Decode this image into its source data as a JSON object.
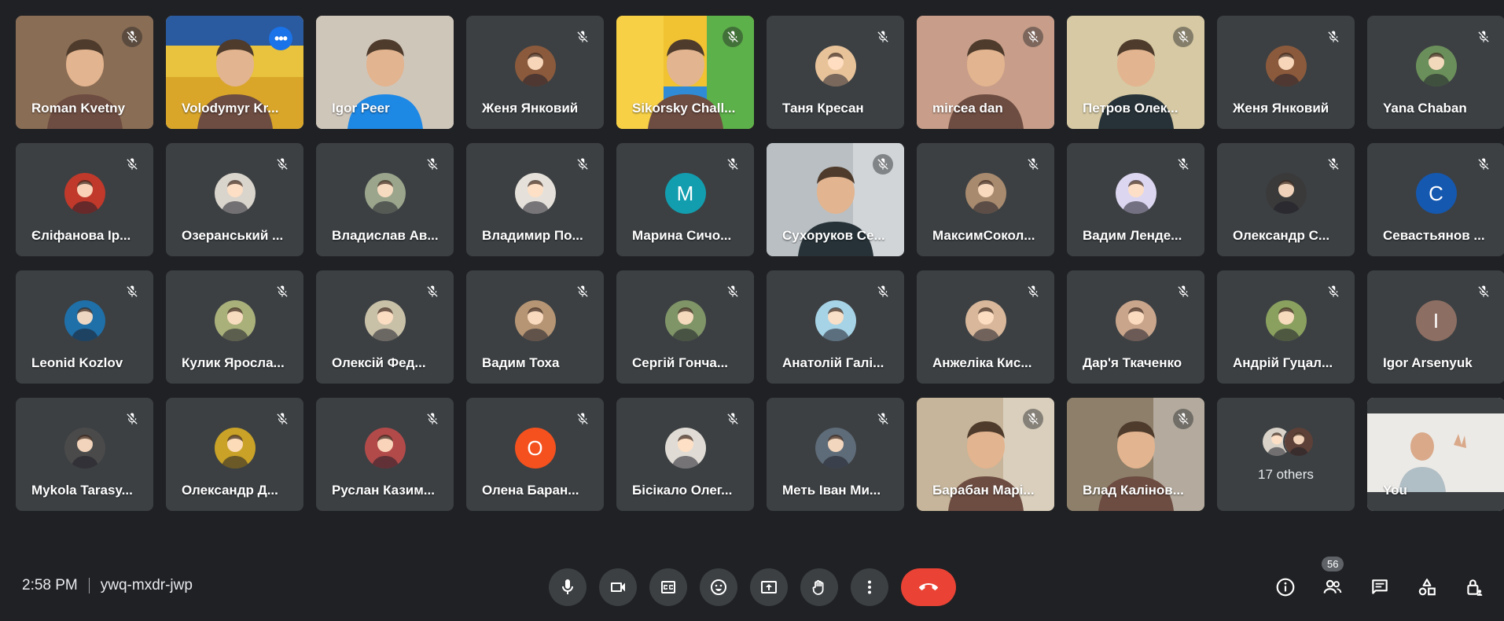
{
  "participants": [
    {
      "name": "Roman Kvetny",
      "type": "video",
      "muted": true,
      "bg": "#8a6d55",
      "scene": "hand"
    },
    {
      "name": "Volodymyr Kr...",
      "type": "video",
      "muted": false,
      "bg": "#d9a62a",
      "scene": "presenter",
      "speaking": true,
      "more": "•••"
    },
    {
      "name": "Igor Peer",
      "type": "video",
      "muted": false,
      "bg": "#d8cfc4",
      "scene": "man-blue"
    },
    {
      "name": "Женя Янковий",
      "type": "avatar",
      "muted": true,
      "avatar": "#8b5a3c"
    },
    {
      "name": "Sikorsky Chall...",
      "type": "video",
      "muted": true,
      "bg": "#f1c232",
      "scene": "woman-color"
    },
    {
      "name": "Таня Кресан",
      "type": "avatar",
      "muted": true,
      "avatar": "#e8c39a"
    },
    {
      "name": "mircea dan",
      "type": "video",
      "muted": true,
      "bg": "#c89e8a",
      "scene": "woman-light"
    },
    {
      "name": "Петров Олек...",
      "type": "video",
      "muted": true,
      "bg": "#d6c9a3",
      "scene": "man-suit"
    },
    {
      "name": "Женя Янковий",
      "type": "avatar",
      "muted": true,
      "avatar": "#8b5a3c"
    },
    {
      "name": "Yana Chaban",
      "type": "avatar",
      "muted": true,
      "avatar": "#6b8f5a"
    },
    {
      "name": "Єліфанова Ір...",
      "type": "avatar",
      "muted": true,
      "avatar": "#c0392b"
    },
    {
      "name": "Озеранський ...",
      "type": "avatar",
      "muted": true,
      "avatar": "#d9d4cc"
    },
    {
      "name": "Владислав Ав...",
      "type": "avatar",
      "muted": true,
      "avatar": "#9aa58c"
    },
    {
      "name": "Владимир По...",
      "type": "avatar",
      "muted": true,
      "avatar": "#e5e1da"
    },
    {
      "name": "Марина Сичо...",
      "type": "letter",
      "muted": true,
      "letter": "M",
      "avatar": "#129eaf"
    },
    {
      "name": "Сухоруков Се...",
      "type": "video",
      "muted": true,
      "bg": "#b9bfc3",
      "scene": "man-office"
    },
    {
      "name": "МаксимСокол...",
      "type": "avatar",
      "muted": true,
      "avatar": "#a88a6e"
    },
    {
      "name": "Вадим Ленде...",
      "type": "avatar",
      "muted": true,
      "avatar": "#dcd6f0"
    },
    {
      "name": "Олександр С...",
      "type": "avatar",
      "muted": true,
      "avatar": "#3a3a3a"
    },
    {
      "name": "Севастьянов ...",
      "type": "letter",
      "muted": true,
      "letter": "C",
      "avatar": "#1558b0"
    },
    {
      "name": "Leonid Kozlov",
      "type": "avatar",
      "muted": true,
      "avatar": "#1f6fa8"
    },
    {
      "name": "Кулик Яросла...",
      "type": "avatar",
      "muted": true,
      "avatar": "#a9b07a"
    },
    {
      "name": "Олексій Фед...",
      "type": "avatar",
      "muted": true,
      "avatar": "#c9c0a8"
    },
    {
      "name": "Вадим Тоха",
      "type": "avatar",
      "muted": true,
      "avatar": "#b59574"
    },
    {
      "name": "Сергій Гонча...",
      "type": "avatar",
      "muted": true,
      "avatar": "#7f9467"
    },
    {
      "name": "Анатолій Галі...",
      "type": "avatar",
      "muted": true,
      "avatar": "#a6d3e6"
    },
    {
      "name": "Анжеліка Кис...",
      "type": "avatar",
      "muted": true,
      "avatar": "#d8b79a"
    },
    {
      "name": "Дар'я Ткаченко",
      "type": "avatar",
      "muted": true,
      "avatar": "#c9a58c"
    },
    {
      "name": "Андрій Гуцал...",
      "type": "avatar",
      "muted": true,
      "avatar": "#8aa05f"
    },
    {
      "name": "Igor Arsenyuk",
      "type": "letter",
      "muted": true,
      "letter": "I",
      "avatar": "#8d6e63"
    },
    {
      "name": "Mykola Tarasy...",
      "type": "avatar",
      "muted": true,
      "avatar": "#4a4a4a"
    },
    {
      "name": "Олександр Д...",
      "type": "avatar",
      "muted": true,
      "avatar": "#c9a227"
    },
    {
      "name": "Руслан Казим...",
      "type": "avatar",
      "muted": true,
      "avatar": "#b34a4a"
    },
    {
      "name": "Олена Баран...",
      "type": "letter",
      "muted": true,
      "letter": "O",
      "avatar": "#f4511e"
    },
    {
      "name": "Бісікало Олег...",
      "type": "avatar",
      "muted": true,
      "avatar": "#e0dcd5"
    },
    {
      "name": "Меть Іван Ми...",
      "type": "avatar",
      "muted": true,
      "avatar": "#5e6b78"
    },
    {
      "name": "Барабан Марі...",
      "type": "video",
      "muted": true,
      "bg": "#c6b59a",
      "scene": "woman-room"
    },
    {
      "name": "Влад Калінов...",
      "type": "video",
      "muted": true,
      "bg": "#8d7f6a",
      "scene": "man-room"
    },
    {
      "name": "17 others",
      "type": "others",
      "muted": false
    },
    {
      "name": "You",
      "type": "self",
      "muted": false,
      "bg": "#e6e4df"
    }
  ],
  "meeting": {
    "time": "2:58 PM",
    "code": "ywq-mxdr-jwp"
  },
  "participants_count": "56",
  "controls": [
    "microphone",
    "camera",
    "captions",
    "reactions",
    "present",
    "raise-hand",
    "more-options",
    "leave-call"
  ],
  "side_icons": [
    "meeting-info",
    "people",
    "chat",
    "activities",
    "host-controls"
  ]
}
